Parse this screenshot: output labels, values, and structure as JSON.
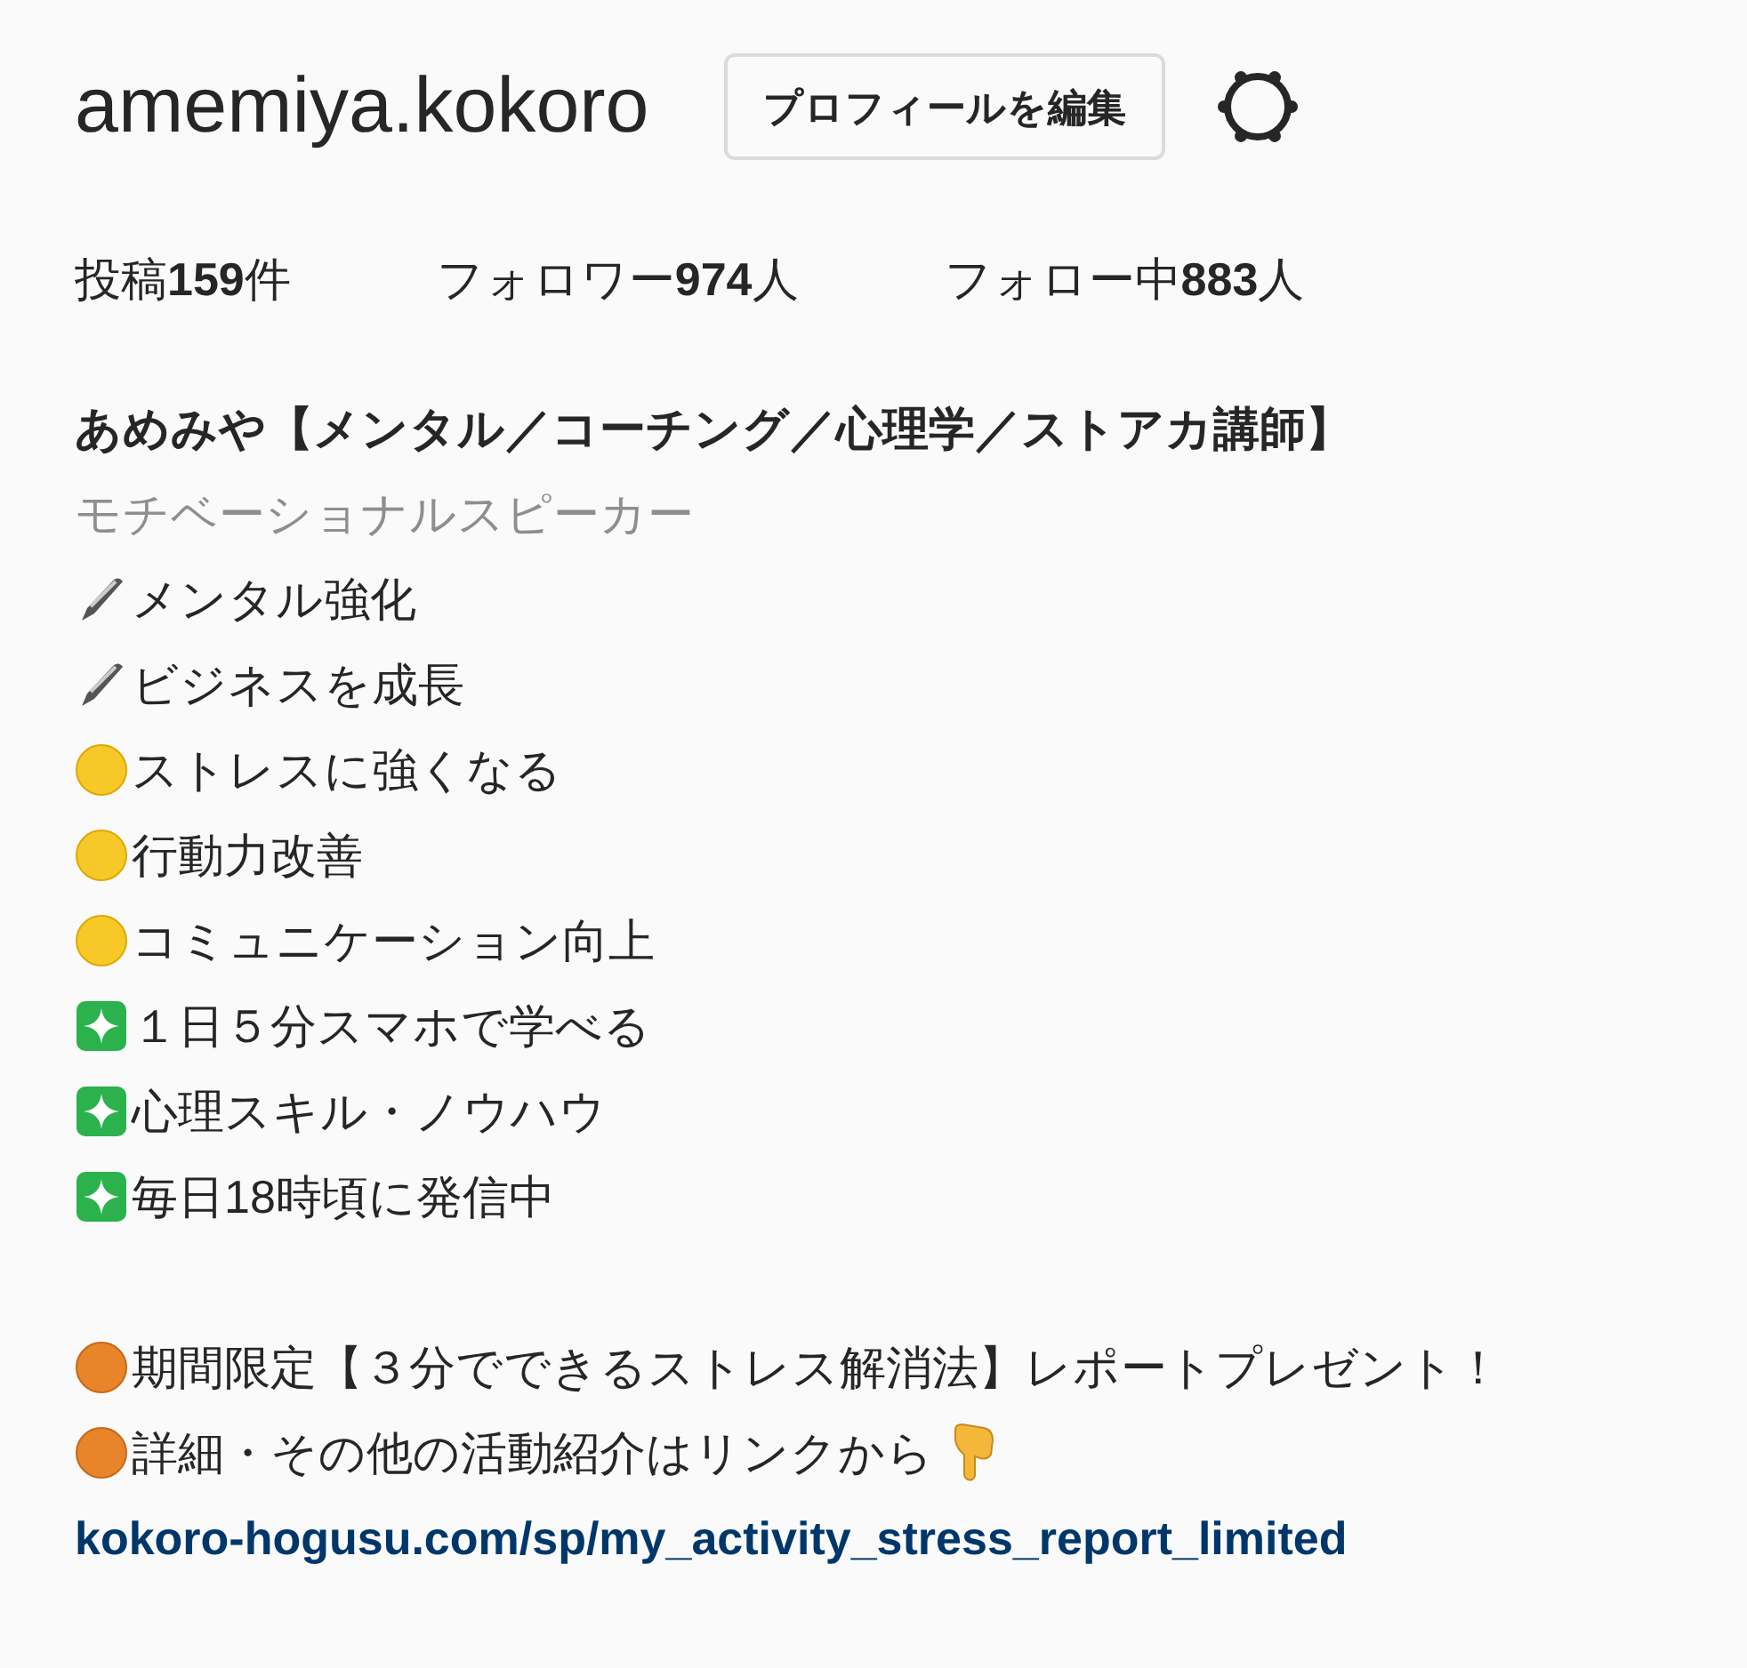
{
  "profile": {
    "username": "amemiya.kokoro",
    "edit_button": "プロフィールを編集"
  },
  "stats": [
    "投稿**159**件",
    "フォロワー**974**人",
    "フォロー中**883**人"
  ],
  "bio": {
    "name": "あめみや【メンタル／コーチング／心理学／ストアカ講師】",
    "category": "モチベーショナルスピーカー",
    "lines": [
      {
        "kind": "pen",
        "text": "メンタル強化"
      },
      {
        "kind": "pen",
        "text": "ビジネスを成長"
      },
      {
        "kind": "yellow",
        "text": "ストレスに強くなる"
      },
      {
        "kind": "yellow",
        "text": "行動力改善"
      },
      {
        "kind": "yellow",
        "text": "コミュニケーション向上"
      },
      {
        "kind": "sparkle",
        "text": "１日５分スマホで学べる"
      },
      {
        "kind": "sparkle",
        "text": "心理スキル・ノウハウ"
      },
      {
        "kind": "sparkle",
        "text": "毎日18時頃に発信中"
      }
    ],
    "notes": [
      {
        "kind": "orange",
        "text": "期間限定【３分でできるストレス解消法】レポートプレゼント！"
      },
      {
        "kind": "pointer",
        "text": "詳細・その他の活動紹介はリンクから"
      }
    ],
    "link": "kokoro-hogusu.com/sp/my_activity_stress_report_limited"
  }
}
